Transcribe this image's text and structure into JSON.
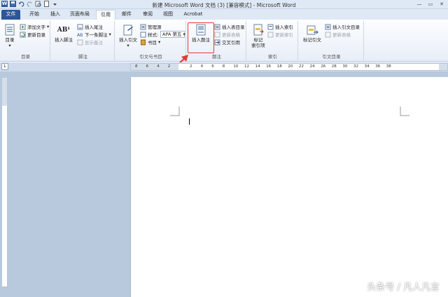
{
  "window": {
    "title": "新建 Microsoft Word 文档 (3) [兼容模式] - Microsoft Word",
    "app_letter": "W",
    "controls": [
      "—",
      "▭",
      "✕"
    ]
  },
  "tabs": [
    "文件",
    "开始",
    "插入",
    "页面布局",
    "引用",
    "邮件",
    "审阅",
    "视图",
    "Acrobat"
  ],
  "active_tab": "引用",
  "ribbon": {
    "toc_group": {
      "label": "目录",
      "toc_button": "目录",
      "add_text": "添加文字",
      "update_toc": "更新目录"
    },
    "footnotes_group": {
      "label": "脚注",
      "insert_footnote": "插入脚注",
      "footnote_icon_text": "AB¹",
      "insert_endnote": "插入尾注",
      "next_footnote": "下一条脚注",
      "show_notes": "显示备注"
    },
    "citations_group": {
      "label": "引文与书目",
      "insert_citation": "插入引文",
      "manage_sources": "管理源",
      "style_label": "样式:",
      "style_value": "APA 第五",
      "bibliography": "书目"
    },
    "captions_group": {
      "label": "题注",
      "insert_caption": "插入题注",
      "insert_table_of_figures": "插入表目录",
      "update_table": "更新表格",
      "cross_reference": "交叉引用"
    },
    "index_group": {
      "label": "索引",
      "mark_entry": "标记\n索引项",
      "insert_index": "插入索引",
      "update_index": "更新索引"
    },
    "toa_group": {
      "label": "引文目录",
      "mark_citation": "标记引文",
      "insert_toa": "插入引文目录",
      "update_toa": "更新表格"
    }
  },
  "ruler": {
    "ticks": [
      "8",
      "6",
      "4",
      "2",
      "",
      "2",
      "4",
      "6",
      "8",
      "10",
      "12",
      "14",
      "16",
      "18",
      "20",
      "22",
      "24",
      "26",
      "28",
      "30",
      "32",
      "34",
      "36",
      "38"
    ]
  },
  "watermark": "头条号 / 凡人凡言",
  "colors": {
    "file_tab": "#2b579a",
    "highlight": "#e53935",
    "workspace": "#b9c9dd"
  }
}
